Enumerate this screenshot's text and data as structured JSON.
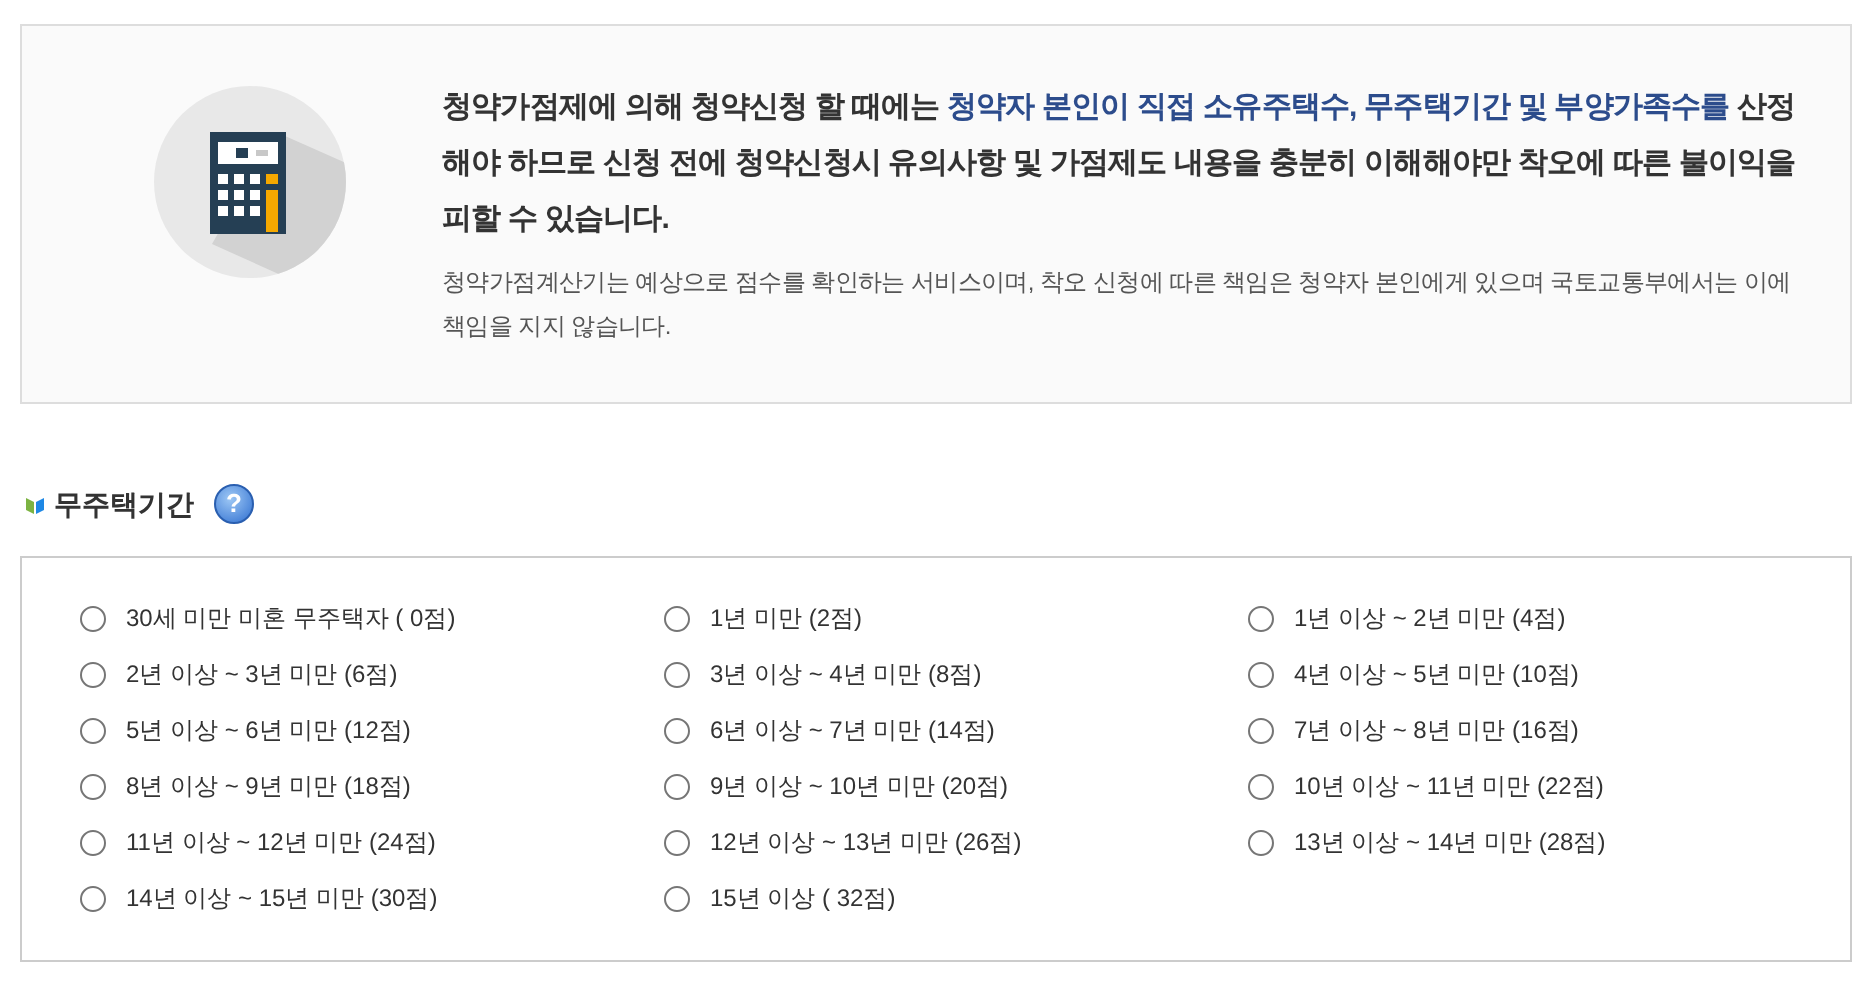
{
  "notice": {
    "main": [
      {
        "text": "청약가점제에 의해 청약신청 할 때에는 ",
        "highlight": false
      },
      {
        "text": "청약자 본인이 직접 소유주택수, 무주택기간 및 부양가족수를",
        "highlight": true
      },
      {
        "text": " 산정해야 하므로 신청 전에 청약신청시 유의사항 및 가점제도 내용을 충분히 이해해야만 착오에 따른 불이익을 피할 수 있습니다.",
        "highlight": false
      }
    ],
    "sub": "청약가점계산기는 예상으로 점수를 확인하는 서비스이며, 착오 신청에 따른 책임은 청약자 본인에게 있으며 국토교통부에서는 이에 책임을 지지 않습니다."
  },
  "section": {
    "title": "무주택기간",
    "help": "?"
  },
  "options": [
    {
      "label": "30세 미만 미혼 무주택자 ( 0점)",
      "selected": false
    },
    {
      "label": "1년 미만 (2점)",
      "selected": false
    },
    {
      "label": "1년 이상 ~ 2년 미만 (4점)",
      "selected": false
    },
    {
      "label": "2년 이상 ~ 3년 미만 (6점)",
      "selected": false
    },
    {
      "label": "3년 이상 ~ 4년 미만 (8점)",
      "selected": false
    },
    {
      "label": "4년 이상 ~ 5년 미만 (10점)",
      "selected": false
    },
    {
      "label": "5년 이상 ~ 6년 미만 (12점)",
      "selected": false
    },
    {
      "label": "6년 이상 ~ 7년 미만 (14점)",
      "selected": false
    },
    {
      "label": "7년 이상 ~ 8년 미만 (16점)",
      "selected": false
    },
    {
      "label": "8년 이상 ~ 9년 미만 (18점)",
      "selected": false
    },
    {
      "label": "9년 이상 ~ 10년 미만 (20점)",
      "selected": false
    },
    {
      "label": "10년 이상 ~ 11년 미만 (22점)",
      "selected": false
    },
    {
      "label": "11년 이상 ~ 12년 미만 (24점)",
      "selected": false
    },
    {
      "label": "12년 이상 ~ 13년 미만 (26점)",
      "selected": false
    },
    {
      "label": "13년 이상 ~ 14년 미만 (28점)",
      "selected": false
    },
    {
      "label": "14년 이상 ~ 15년 미만 (30점)",
      "selected": false
    },
    {
      "label": "15년 이상 ( 32점)",
      "selected": false
    }
  ]
}
